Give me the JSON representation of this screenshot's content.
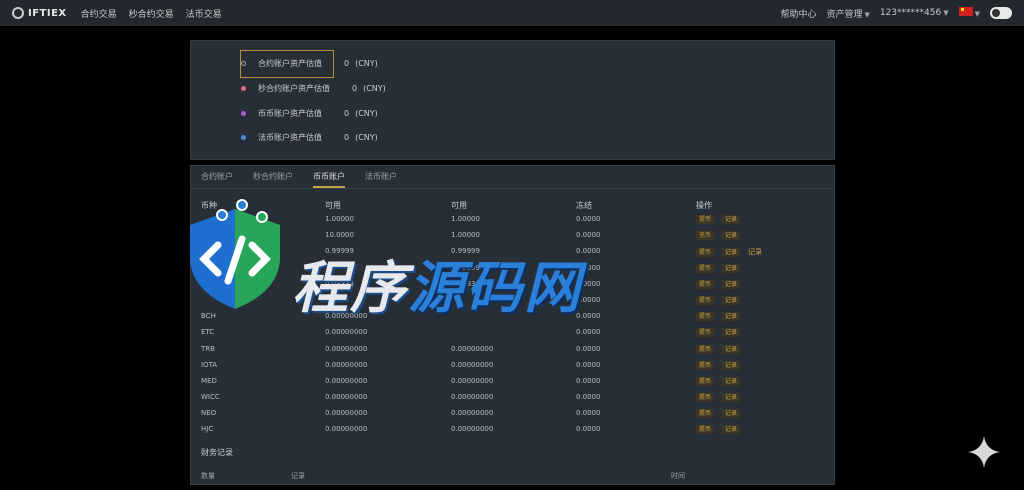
{
  "brand": {
    "name": "IFTIEX"
  },
  "nav": {
    "items": [
      "合约交易",
      "秒合约交易",
      "法币交易"
    ]
  },
  "header_right": {
    "help": "帮助中心",
    "asset_mgmt": "资产管理",
    "user": "123******456"
  },
  "summary": {
    "rows": [
      {
        "label": "合约账户资产估值",
        "value": "0",
        "unit": "(CNY)",
        "color": "#2b2f33"
      },
      {
        "label": "秒合约账户资产估值",
        "value": "0",
        "unit": "(CNY)",
        "color": "#e06a8a"
      },
      {
        "label": "币币账户资产估值",
        "value": "0",
        "unit": "(CNY)",
        "color": "#b05ad8"
      },
      {
        "label": "法币账户资产估值",
        "value": "0",
        "unit": "(CNY)",
        "color": "#4a8ee0"
      }
    ]
  },
  "tabs": [
    "合约账户",
    "秒合约账户",
    "币币账户",
    "法币账户"
  ],
  "table": {
    "headers": [
      "币种",
      "可用",
      "可用",
      "冻结",
      "操作"
    ],
    "rows": [
      {
        "coin": "",
        "a": "1.00000",
        "b": "1.00000",
        "c": "0.0000",
        "ops": [
          "提币",
          "记录"
        ],
        "extra": ""
      },
      {
        "coin": "",
        "a": "10.0000",
        "b": "1.00000",
        "c": "0.0000",
        "ops": [
          "充币",
          "记录"
        ],
        "extra": ""
      },
      {
        "coin": "",
        "a": "0.99999",
        "b": "0.99999",
        "c": "0.0000",
        "ops": [
          "提币",
          "记录"
        ],
        "extra": "记录"
      },
      {
        "coin": "",
        "a": "",
        "b": "0.99999",
        "c": "0.0000",
        "ops": [
          "提币",
          "记录"
        ],
        "extra": ""
      },
      {
        "coin": "",
        "a": "0.03333",
        "b": "0.03333",
        "c": "0.0000",
        "ops": [
          "提币",
          "记录"
        ],
        "extra": ""
      },
      {
        "coin": "",
        "a": "",
        "b": "",
        "c": "0.0000",
        "ops": [
          "提币",
          "记录"
        ],
        "extra": ""
      },
      {
        "coin": "BCH",
        "a": "0.00000000",
        "b": "",
        "c": "0.0000",
        "ops": [
          "提币",
          "记录"
        ],
        "extra": ""
      },
      {
        "coin": "ETC",
        "a": "0.00000000",
        "b": "",
        "c": "0.0000",
        "ops": [
          "提币",
          "记录"
        ],
        "extra": ""
      },
      {
        "coin": "TRB",
        "a": "0.00000000",
        "b": "0.00000000",
        "c": "0.0000",
        "ops": [
          "提币",
          "记录"
        ],
        "extra": ""
      },
      {
        "coin": "IOTA",
        "a": "0.00000000",
        "b": "0.00000000",
        "c": "0.0000",
        "ops": [
          "提币",
          "记录"
        ],
        "extra": ""
      },
      {
        "coin": "MED",
        "a": "0.00000000",
        "b": "0.00000000",
        "c": "0.0000",
        "ops": [
          "提币",
          "记录"
        ],
        "extra": ""
      },
      {
        "coin": "WICC",
        "a": "0.00000000",
        "b": "0.00000000",
        "c": "0.0000",
        "ops": [
          "提币",
          "记录"
        ],
        "extra": ""
      },
      {
        "coin": "NEO",
        "a": "0.00000000",
        "b": "0.00000000",
        "c": "0.0000",
        "ops": [
          "提币",
          "记录"
        ],
        "extra": ""
      },
      {
        "coin": "HJC",
        "a": "0.00000000",
        "b": "0.00000000",
        "c": "0.0000",
        "ops": [
          "提币",
          "记录"
        ],
        "extra": ""
      }
    ]
  },
  "records": {
    "title": "财务记录",
    "headers": [
      "数量",
      "记录",
      "时间"
    ]
  },
  "watermark": {
    "text_a": "程序",
    "text_b": "源码网"
  },
  "colors": {
    "accent": "#c9a14a",
    "panel": "#272e35",
    "topbar": "#23282e"
  }
}
